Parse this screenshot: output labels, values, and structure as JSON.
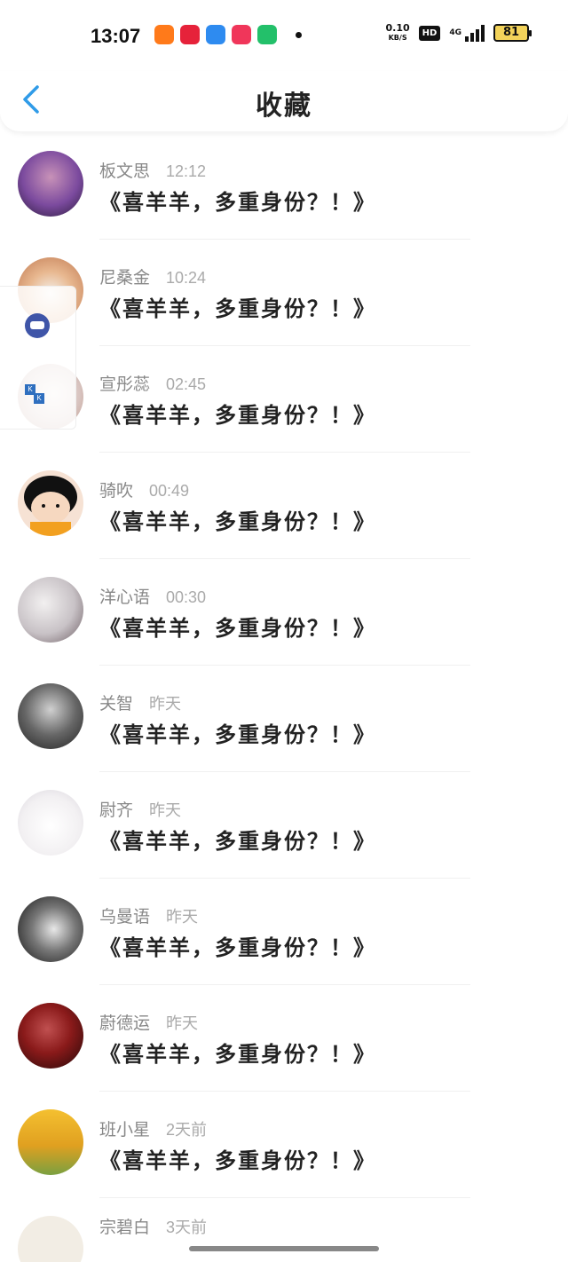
{
  "status_bar": {
    "time": "13:07",
    "net_speed_value": "0.10",
    "net_speed_unit": "KB/S",
    "hd": "HD",
    "network": "4G",
    "battery": "81",
    "app_icon_colors": [
      "#ff7a1a",
      "#e6223a",
      "#2e8bf0",
      "#f0365a",
      "#23c06a"
    ]
  },
  "header": {
    "title": "收藏",
    "back_icon": "chevron-left-icon",
    "accent": "#2f9be8"
  },
  "list": [
    {
      "name": "板文思",
      "time": "12:12",
      "message": "《喜羊羊，多重身份？！》"
    },
    {
      "name": "尼桑金",
      "time": "10:24",
      "message": "《喜羊羊，多重身份？！》"
    },
    {
      "name": "宣彤蕊",
      "time": "02:45",
      "message": "《喜羊羊，多重身份？！》"
    },
    {
      "name": "骑吹",
      "time": "00:49",
      "message": "《喜羊羊，多重身份？！》"
    },
    {
      "name": "洋心语",
      "time": "00:30",
      "message": "《喜羊羊，多重身份？！》"
    },
    {
      "name": "关智",
      "time": "昨天",
      "message": "《喜羊羊，多重身份？！》"
    },
    {
      "name": "尉齐",
      "time": "昨天",
      "message": "《喜羊羊，多重身份？！》"
    },
    {
      "name": "乌曼语",
      "time": "昨天",
      "message": "《喜羊羊，多重身份？！》"
    },
    {
      "name": "蔚德运",
      "time": "昨天",
      "message": "《喜羊羊，多重身份？！》"
    },
    {
      "name": "班小星",
      "time": "2天前",
      "message": "《喜羊羊，多重身份？！》"
    },
    {
      "name": "宗碧白",
      "time": "3天前",
      "message": ""
    }
  ],
  "avatar_colors": [
    "#7b4a9e",
    "#d9a07a",
    "#d8c4c0",
    "#f0c8b0",
    "#c8c2c6",
    "#555555",
    "#eeeeee",
    "#333333",
    "#8a1a1a",
    "#e0a020",
    "#f2ede4"
  ]
}
